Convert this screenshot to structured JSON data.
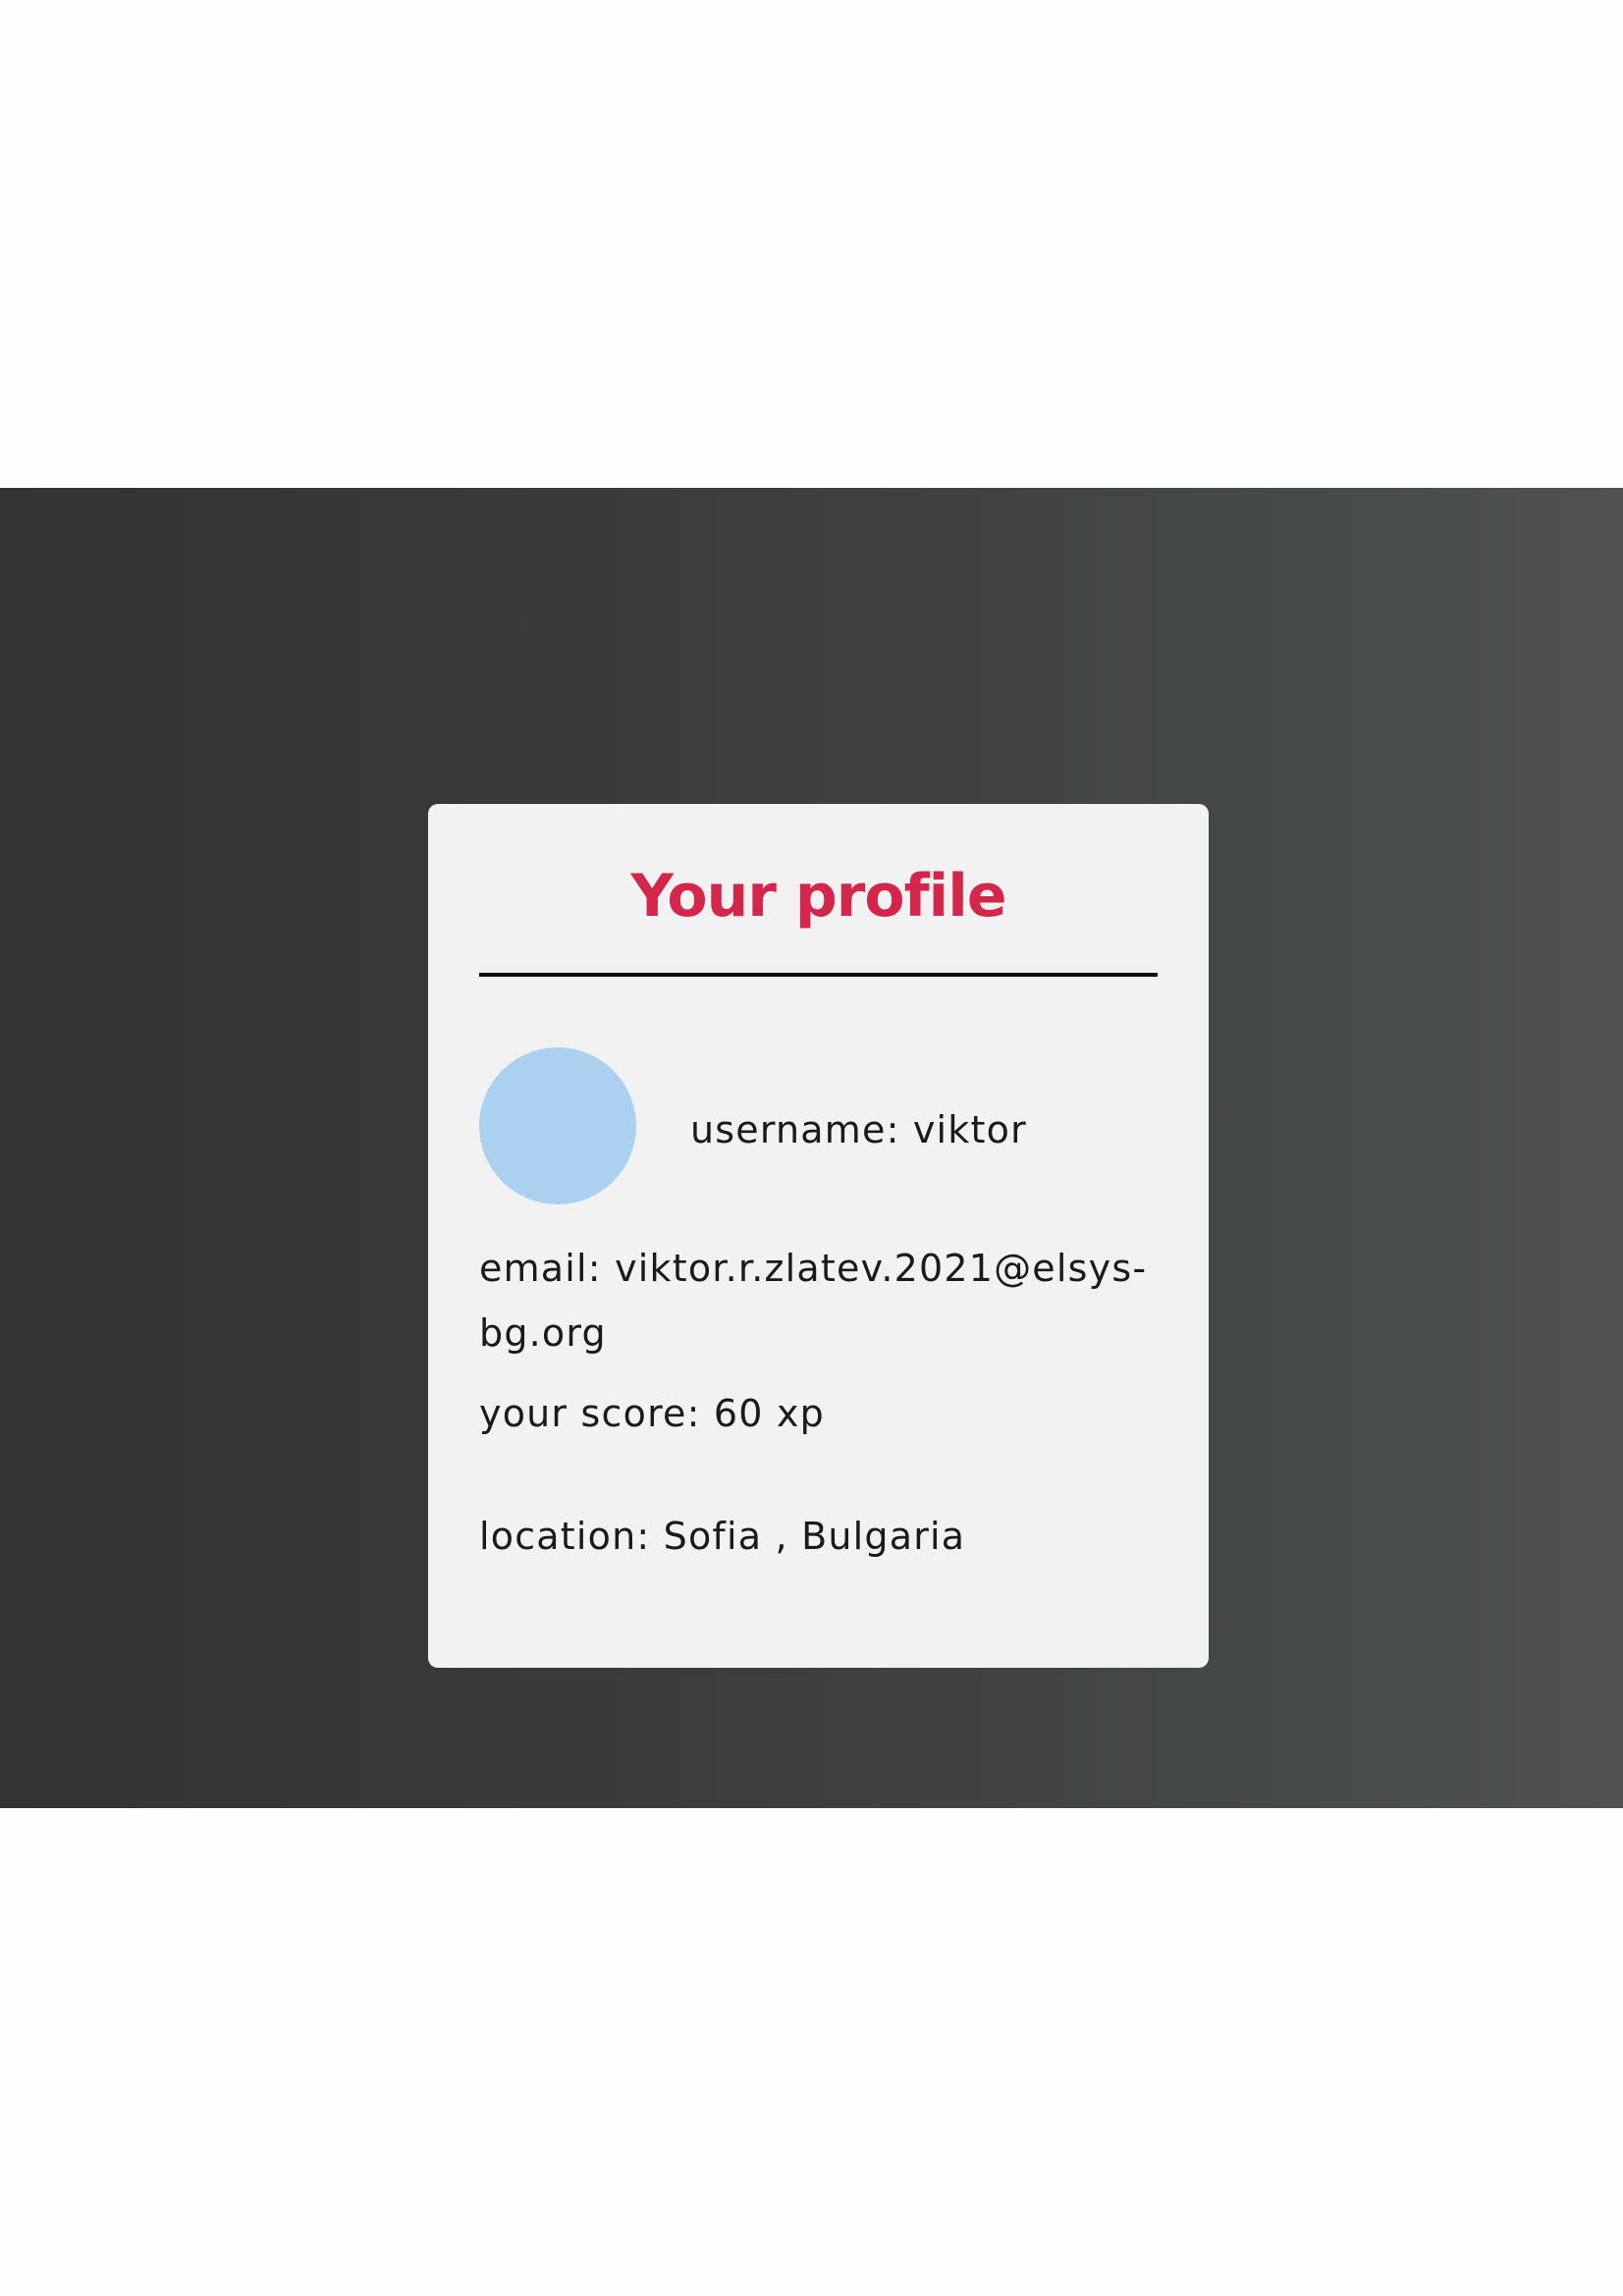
{
  "profile_card": {
    "title": "Your profile",
    "username_text": "username: viktor",
    "email_text": "email: viktor.r.zlatev.2021@elsys-bg.org",
    "score_text": "your score: 60 xp",
    "location_text": "location: Sofia , Bulgaria"
  },
  "colors": {
    "title": "#d4264a",
    "avatar": "#acd0f0",
    "card_background": "#f2f2f2",
    "page_background": "#333333"
  }
}
